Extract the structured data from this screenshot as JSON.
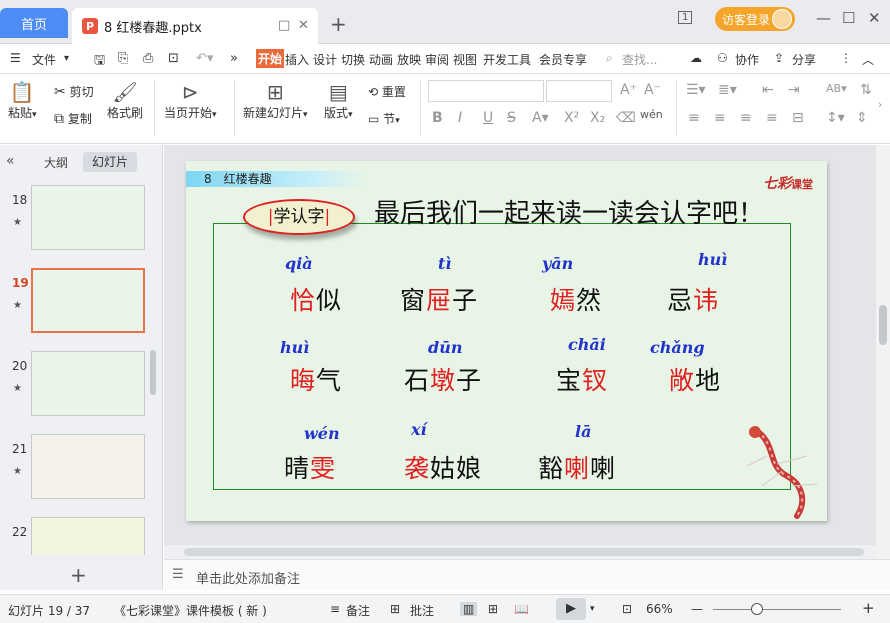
{
  "tabs": {
    "home_label": "首页",
    "file_icon_text": "P",
    "file_label": "8 红楼春趣.pptx",
    "restore_icon": "□",
    "close_icon": "✕",
    "new_tab": "+"
  },
  "titlebar": {
    "panel_icon_text": "1",
    "login_label": "访客登录",
    "min_icon": "—",
    "max_icon": "☐",
    "close_icon": "✕"
  },
  "menubar": {
    "file_label": "文件",
    "items": [
      "开始",
      "插入",
      "设计",
      "切换",
      "动画",
      "放映",
      "审阅",
      "视图",
      "开发工具",
      "会员专享"
    ],
    "search_placeholder": "查找...",
    "collab_label": "协作",
    "share_label": "分享",
    "more_icon": "⋮",
    "collapse_icon": "︿"
  },
  "ribbon": {
    "paste": "粘贴",
    "cut": "剪切",
    "copy": "复制",
    "format_painter": "格式刷",
    "play_from_current": "当页开始",
    "new_slide": "新建幻灯片",
    "layout": "版式",
    "reset": "重置",
    "section": "节",
    "wen_label": "wén"
  },
  "left_panel": {
    "outline_tab": "大纲",
    "slides_tab": "幻灯片",
    "collapse_icon": "«",
    "star_icon": "★",
    "add_icon": "+",
    "thumbnails": [
      {
        "number": "18",
        "current": false
      },
      {
        "number": "19",
        "current": true
      },
      {
        "number": "20",
        "current": false
      },
      {
        "number": "21",
        "current": false
      },
      {
        "number": "22",
        "current": false
      }
    ]
  },
  "slide": {
    "header_text": "8　红楼春趣",
    "logo_text": "七彩",
    "logo_sub": "课堂",
    "badge_text": "学认字",
    "title": "最后我们一起来读一读会认字吧！",
    "items": [
      {
        "pinyin": "qià",
        "pre": "",
        "red": "恰",
        "post": "似"
      },
      {
        "pinyin": "tì",
        "pre": "窗",
        "red": "屉",
        "post": "子"
      },
      {
        "pinyin": "yān",
        "pre": "",
        "red": "嫣",
        "post": "然"
      },
      {
        "pinyin": "huì",
        "pre": "忌",
        "red": "讳",
        "post": ""
      },
      {
        "pinyin": "huì",
        "pre": "",
        "red": "晦",
        "post": "气"
      },
      {
        "pinyin": "dūn",
        "pre": "石",
        "red": "墩",
        "post": "子"
      },
      {
        "pinyin": "chāi",
        "pre": "宝",
        "red": "钗",
        "post": ""
      },
      {
        "pinyin": "chǎng",
        "pre": "",
        "red": "敞",
        "post": "地"
      },
      {
        "pinyin": "wén",
        "pre": "晴",
        "red": "雯",
        "post": ""
      },
      {
        "pinyin": "xí",
        "pre": "",
        "red": "袭",
        "post": "姑娘"
      },
      {
        "pinyin": "lā",
        "pre": "豁",
        "red": "喇",
        "post": "喇"
      }
    ]
  },
  "notes": {
    "placeholder": "单击此处添加备注"
  },
  "status": {
    "slide_counter": "幻灯片 19 / 37",
    "template": "《七彩课堂》课件模板 ( 新 )",
    "notes_label": "备注",
    "comments_label": "批注",
    "zoom": "66%",
    "zoom_minus": "—",
    "zoom_plus": "+"
  },
  "colors": {
    "accent": "#4d8bf5",
    "ribbon_active": "#ea6a3a",
    "login": "#f4a52a",
    "slide_red": "#e02020",
    "pinyin_blue": "#2233cc"
  }
}
